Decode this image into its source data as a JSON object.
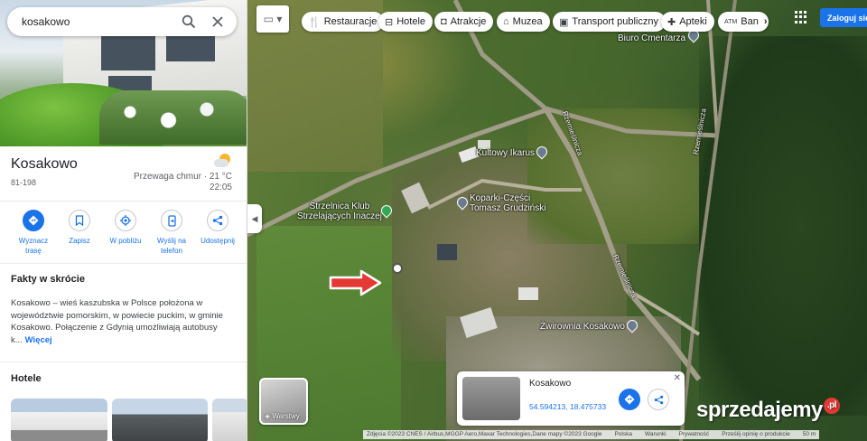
{
  "search": {
    "value": "kosakowo"
  },
  "place": {
    "title": "Kosakowo",
    "postal_code": "81-198",
    "weather": {
      "condition": "Przewaga chmur",
      "temperature": "21 °C",
      "time": "22:05"
    }
  },
  "actions": [
    {
      "label": "Wyznacz trasę",
      "icon": "directions-icon"
    },
    {
      "label": "Zapisz",
      "icon": "bookmark-icon"
    },
    {
      "label": "W pobliżu",
      "icon": "nearby-icon"
    },
    {
      "label": "Wyślij na telefon",
      "icon": "send-to-phone-icon"
    },
    {
      "label": "Udostępnij",
      "icon": "share-icon"
    }
  ],
  "facts": {
    "title": "Fakty w skrócie",
    "text": "Kosakowo – wieś kaszubska w Polsce położona w województwie pomorskim, w powiecie puckim, w gminie Kosakowo. Połączenie z Gdynią umożliwiają autobusy k...",
    "more_label": "Więcej"
  },
  "hotels": {
    "title": "Hotele"
  },
  "map_categories": [
    {
      "label": "Restauracje",
      "icon": "fork-knife-icon"
    },
    {
      "label": "Hotele",
      "icon": "bed-icon"
    },
    {
      "label": "Atrakcje",
      "icon": "camera-icon"
    },
    {
      "label": "Muzea",
      "icon": "museum-icon"
    },
    {
      "label": "Transport publiczny",
      "icon": "bus-icon"
    },
    {
      "label": "Apteki",
      "icon": "pharmacy-icon"
    },
    {
      "label": "Ban",
      "icon": "atm-icon"
    }
  ],
  "signin": {
    "label": "Zaloguj się"
  },
  "map_labels": {
    "cemetery_office": "Biuro Cmentarza",
    "pub": "Kultowy Ikarus",
    "street1": "Rzemieślnicza",
    "street2": "Rzemieślnicza",
    "street3": "Rzemieślnicza",
    "shooting_club": "Strzelnica Klub\nStrzelających Inaczej",
    "parts": "Koparki-Części\nTomasz Grudziński",
    "gravel": "Żwirownia Kosakowo"
  },
  "layers": {
    "label": "Warstwy"
  },
  "info_card": {
    "title": "Kosakowo",
    "coords": "54.594213, 18.475733"
  },
  "attribution": {
    "images": "Zdjęcia ©2023 CNES / Airbus,MGGP Aero,Maxar Technologies,Dane mapy ©2023 Google",
    "country": "Polska",
    "terms": "Warunki",
    "privacy": "Prywatność",
    "feedback": "Prześlij opinię o produkcie",
    "scale": "50 m"
  },
  "watermark": {
    "text": "sprzedajemy",
    "badge": ".pl"
  },
  "colors": {
    "accent": "#1a73e8",
    "pin_green": "#34a853",
    "pin_gray": "#6b7c8f",
    "arrow": "#e53935"
  }
}
